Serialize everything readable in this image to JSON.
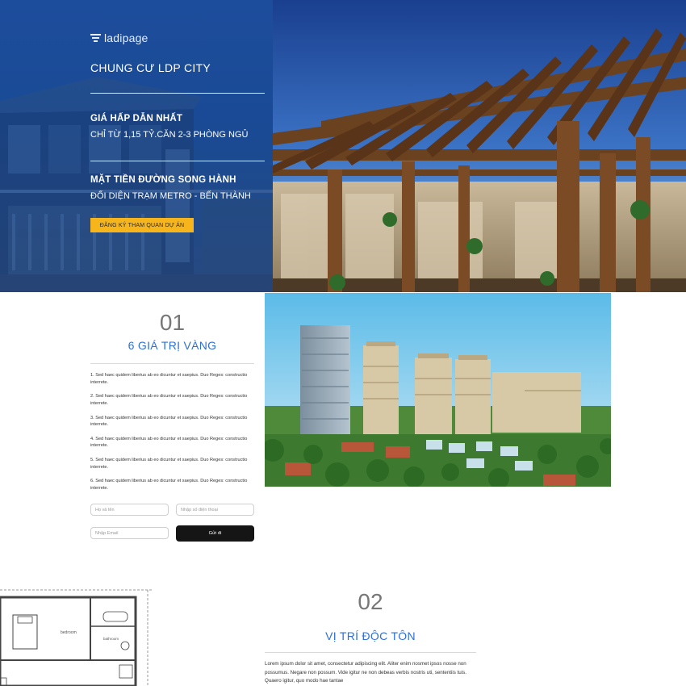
{
  "hero": {
    "logo_text": "ladipage",
    "title": "CHUNG CƯ LDP CITY",
    "feature1_title": "GIÁ HẤP DẪN NHẤT",
    "feature1_sub": "CHỈ TỪ 1,15 TỶ.CĂN 2-3 PHÒNG NGỦ",
    "feature2_title": "MẶT TIỀN ĐƯỜNG SONG HÀNH",
    "feature2_sub": "ĐỐI DIỆN TRẠM METRO - BẾN THÀNH",
    "cta_label": "ĐĂNG KÝ THAM QUAN DỰ ÁN"
  },
  "section1": {
    "number": "01",
    "heading": "6 GIÁ TRỊ VÀNG",
    "items": [
      "1. Sed haec quidem liberius ab eo dicuntur et saepius. Duo Reges: constructio interrete.",
      "2. Sed haec quidem liberius ab eo dicuntur et saepius. Duo Reges: constructio interrete.",
      "3. Sed haec quidem liberius ab eo dicuntur et saepius. Duo Reges: constructio interrete.",
      "4. Sed haec quidem liberius ab eo dicuntur et saepius. Duo Reges: constructio interrete.",
      "5. Sed haec quidem liberius ab eo dicuntur et saepius. Duo Reges: constructio interrete.",
      "6. Sed haec quidem liberius ab eo dicuntur et saepius. Duo Reges: constructio interrete."
    ],
    "form": {
      "name_placeholder": "Họ và tên",
      "phone_placeholder": "Nhập số điện thoại",
      "email_placeholder": "Nhập Email",
      "submit_label": "Gửi đi"
    }
  },
  "section2": {
    "number": "02",
    "heading": "VỊ TRÍ ĐỘC TÔN",
    "text": "Lorem ipsum dolor sit amet, consectetur adipiscing elit. Aliter enim nosmet ipsos nosse non possumus. Negare non possum. Vide igitur ne non debeas verbis nostris uti, sententiis tuis. Quaero igitur, quo modo hae tantae",
    "floorplan_labels": {
      "bedroom": "bedroom",
      "bathroom": "bathroom"
    }
  },
  "colors": {
    "hero_blue": "#1c4d9c",
    "accent_yellow": "#f6b51a",
    "heading_blue": "#2f6fd4",
    "button_dark": "#151515"
  },
  "icons": {
    "logo": "ladipage-logo-icon"
  }
}
